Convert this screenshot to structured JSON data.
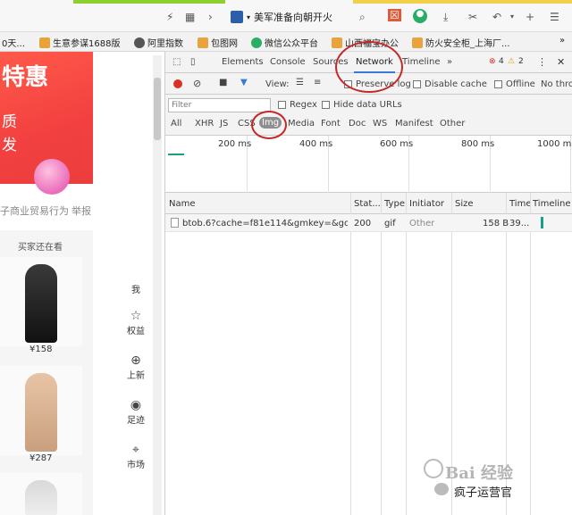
{
  "browser": {
    "tab_title": "美军准备向朝开火",
    "bookmarks": [
      {
        "label": "0天...",
        "color": ""
      },
      {
        "label": "生意参谋1688版",
        "color": "#e8a33c"
      },
      {
        "label": "阿里指数",
        "color": "#555555"
      },
      {
        "label": "包图网",
        "color": "#e8a33c"
      },
      {
        "label": "微信公众平台",
        "color": "#2aae67"
      },
      {
        "label": "山西福宝办公",
        "color": "#e8a33c"
      },
      {
        "label": "防火安全柜_上海厂...",
        "color": "#e8a33c"
      }
    ]
  },
  "page": {
    "banner_big": "特惠",
    "banner_line1": "质",
    "banner_line2": "发",
    "trade_text": "子商业贸易行为",
    "report_text": "举报",
    "recs_title": "买家还在看",
    "products": [
      {
        "price": "¥158"
      },
      {
        "price": "¥287"
      }
    ],
    "sidebar": [
      {
        "icon": "",
        "label": "我"
      },
      {
        "icon": "☆",
        "label": "权益"
      },
      {
        "icon": "⊕",
        "label": "上新"
      },
      {
        "icon": "◉",
        "label": "足迹"
      },
      {
        "icon": "⌖",
        "label": "市场"
      }
    ]
  },
  "devtools": {
    "tabs": [
      "Elements",
      "Console",
      "Sources",
      "Network",
      "Timeline"
    ],
    "active_tab": "Network",
    "more": "»",
    "errors": "4",
    "warnings": "2",
    "view_label": "View:",
    "preserve_log": "Preserve log",
    "disable_cache": "Disable cache",
    "offline": "Offline",
    "throttle": "No throt",
    "filter_placeholder": "Filter",
    "regex": "Regex",
    "hide_data_urls": "Hide data URLs",
    "types": [
      "All",
      "XHR",
      "JS",
      "CSS",
      "Img",
      "Media",
      "Font",
      "Doc",
      "WS",
      "Manifest",
      "Other"
    ],
    "selected_type": "Img",
    "ticks": [
      "200 ms",
      "400 ms",
      "600 ms",
      "800 ms",
      "1000 ms"
    ],
    "columns": [
      "Name",
      "Stat...",
      "Type",
      "Initiator",
      "Size",
      "Time",
      "Timeline –"
    ],
    "rows": [
      {
        "name": "btob.6?cache=f81e114&gmkey=&goke...",
        "status": "200",
        "type": "gif",
        "initiator": "Other",
        "size": "158 B",
        "time": "39..."
      }
    ]
  },
  "watermark": {
    "text": "Bai 经验",
    "account": "疯子运营官"
  }
}
